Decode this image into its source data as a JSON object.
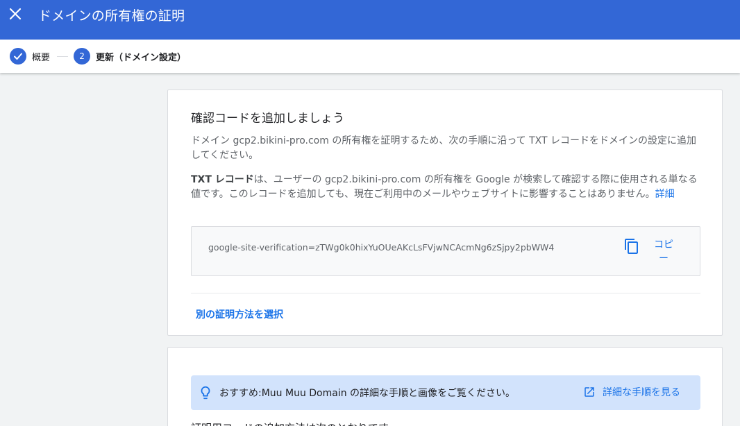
{
  "header": {
    "title": "ドメインの所有権の証明",
    "close_icon": "close-icon"
  },
  "stepper": {
    "steps": [
      {
        "marker": "✓",
        "label": "概要",
        "status": "complete"
      },
      {
        "marker": "2",
        "label": "更新（ドメイン設定）",
        "status": "active"
      }
    ]
  },
  "verification_card": {
    "title": "確認コードを追加しましょう",
    "intro": "ドメイン gcp2.bikini-pro.com の所有権を証明するため、次の手順に沿って TXT レコードをドメインの設定に追加してください。",
    "txt_term": "TXT レコード",
    "txt_description": "は、ユーザーの gcp2.bikini-pro.com の所有権を Google が検索して確認する際に使用される単なる値です。このレコードを追加しても、現在ご利用中のメールやウェブサイトに影響することはありません。",
    "details_link": "詳細",
    "verification_code": "google-site-verification=zTWg0k0hixYuOUeAKcLsFVjwNCAcmNg6zSjpy2pbWW4",
    "copy_label": "コピー",
    "alt_method_link": "別の証明方法を選択"
  },
  "tip_card": {
    "tip_text": "おすすめ:Muu Muu Domain の詳細な手順と画像をご覧ください。",
    "tip_link": "詳細な手順を見る",
    "partial_text": "証明用コードの追加方法は次のとおりです"
  },
  "colors": {
    "primary": "#3367d6",
    "link": "#1a73e8",
    "tip_background": "#d2e3fc",
    "page_background": "#f1f3f4"
  }
}
